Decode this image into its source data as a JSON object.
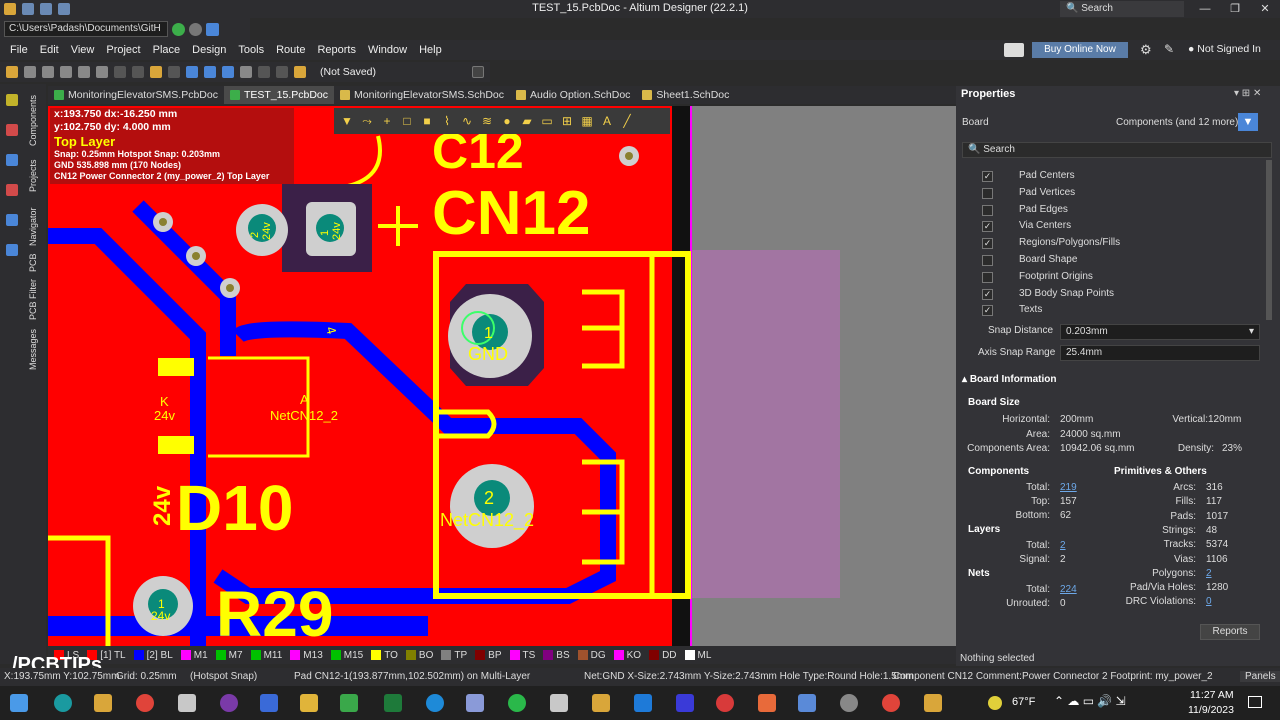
{
  "window": {
    "title": "TEST_15.PcbDoc - Altium Designer (22.2.1)",
    "search": "Search"
  },
  "path": "C:\\Users\\Padash\\Documents\\GitH",
  "menu": [
    "File",
    "Edit",
    "View",
    "Project",
    "Place",
    "Design",
    "Tools",
    "Route",
    "Reports",
    "Window",
    "Help"
  ],
  "top_right": {
    "buy": "Buy Online Now",
    "signin": "Not Signed In"
  },
  "toolbar": {
    "saved": "(Not Saved)"
  },
  "tabs": [
    "MonitoringElevatorSMS.PcbDoc",
    "TEST_15.PcbDoc",
    "MonitoringElevatorSMS.SchDoc",
    "Audio Option.SchDoc",
    "Sheet1.SchDoc"
  ],
  "left_panels": [
    "Components",
    "Projects",
    "Navigator",
    "PCB",
    "PCB Filter",
    "Messages"
  ],
  "info": {
    "l1": "x:193.750   dx:-16.250 mm",
    "l2": "y:102.750   dy:  4.000  mm",
    "layer": "Top Layer",
    "l3": "Snap: 0.25mm Hotspot Snap: 0.203mm",
    "l4": "GND  535.898 mm (170 Nodes)",
    "l5": "CN12  Power Connector 2 (my_power_2)  Top Layer"
  },
  "pcb": {
    "c12": "C12",
    "cn12": "CN12",
    "d10": "D10",
    "r29": "R29",
    "k": "K",
    "v24a": "24v",
    "a": "A",
    "net": "NetCN12_2",
    "v24b": "24v",
    "pad1": "1",
    "gnd": "GND",
    "pad2": "2",
    "net2": "NetCN12_2",
    "p1b": "1",
    "v24c": "24v",
    "p2a": "2",
    "v24d": "24v",
    "p1a": "1",
    "v24e": "24v",
    "four": "4"
  },
  "layers": [
    {
      "n": "LS",
      "c": "#ff0000"
    },
    {
      "n": "[1] TL",
      "c": "#ff0000"
    },
    {
      "n": "[2] BL",
      "c": "#0000ff"
    },
    {
      "n": "M1",
      "c": "#ff00ff"
    },
    {
      "n": "M7",
      "c": "#00c000"
    },
    {
      "n": "M11",
      "c": "#00c000"
    },
    {
      "n": "M13",
      "c": "#ff00ff"
    },
    {
      "n": "M15",
      "c": "#00c000"
    },
    {
      "n": "TO",
      "c": "#ffff00"
    },
    {
      "n": "BO",
      "c": "#808000"
    },
    {
      "n": "TP",
      "c": "#808080"
    },
    {
      "n": "BP",
      "c": "#800000"
    },
    {
      "n": "TS",
      "c": "#ff00ff"
    },
    {
      "n": "BS",
      "c": "#800080"
    },
    {
      "n": "DG",
      "c": "#a0522d"
    },
    {
      "n": "KO",
      "c": "#ff00ff"
    },
    {
      "n": "DD",
      "c": "#800000"
    },
    {
      "n": "ML",
      "c": "#ffffff"
    }
  ],
  "props": {
    "title": "Properties",
    "board": "Board",
    "components": "Components (and 12 more)",
    "search": "Search",
    "snap_items": [
      {
        "label": "Pad Centers",
        "checked": true
      },
      {
        "label": "Pad Vertices",
        "checked": false
      },
      {
        "label": "Pad Edges",
        "checked": false
      },
      {
        "label": "Via Centers",
        "checked": true
      },
      {
        "label": "Regions/Polygons/Fills",
        "checked": true
      },
      {
        "label": "Board Shape",
        "checked": false
      },
      {
        "label": "Footprint Origins",
        "checked": false
      },
      {
        "label": "3D Body Snap Points",
        "checked": true
      },
      {
        "label": "Texts",
        "checked": true
      }
    ],
    "snap_distance_label": "Snap Distance",
    "snap_distance": "0.203mm",
    "axis_label": "Axis Snap Range",
    "axis": "25.4mm",
    "board_info": "Board Information",
    "board_size": "Board Size",
    "horizontal_l": "Horizontal:",
    "horizontal": "200mm",
    "vertical_l": "Vertical:",
    "vertical": "120mm",
    "area_l": "Area:",
    "area": "24000 sq.mm",
    "comp_area_l": "Components Area:",
    "comp_area": "10942.06 sq.mm",
    "density_l": "Density:",
    "density": "23%",
    "components_h": "Components",
    "total_l": "Total:",
    "total": "219",
    "top_l": "Top:",
    "top": "157",
    "bottom_l": "Bottom:",
    "bottom": "62",
    "layers_h": "Layers",
    "ltotal_l": "Total:",
    "ltotal": "2",
    "signal_l": "Signal:",
    "signal": "2",
    "nets_h": "Nets",
    "ntotal_l": "Total:",
    "ntotal": "224",
    "unrouted_l": "Unrouted:",
    "unrouted": "0",
    "prims_h": "Primitives & Others",
    "arcs_l": "Arcs:",
    "arcs": "316",
    "fills_l": "Fills:",
    "fills": "117",
    "pads_l": "Pads:",
    "pads": "1017",
    "strings_l": "Strings:",
    "strings": "48",
    "tracks_l": "Tracks:",
    "tracks": "5374",
    "vias_l": "Vias:",
    "vias": "1106",
    "polygons_l": "Polygons:",
    "polygons": "2",
    "holes_l": "Pad/Via Holes:",
    "holes": "1280",
    "drc_l": "DRC Violations:",
    "drc": "0",
    "reports": "Reports",
    "nothing": "Nothing selected"
  },
  "status": {
    "coords": "X:193.75mm Y:102.75mm",
    "grid": "Grid: 0.25mm",
    "snap": "(Hotspot Snap)",
    "pad": "Pad CN12-1(193.877mm,102.502mm) on Multi-Layer",
    "net": "Net:GND X-Size:2.743mm Y-Size:2.743mm Hole Type:Round Hole:1.5mm",
    "comp": "Component CN12 Comment:Power Connector 2 Footprint: my_power_2",
    "panels": "Panels"
  },
  "taskbar": {
    "temp": "67°F",
    "time": "11:27 AM",
    "date": "11/9/2023"
  },
  "watermark": "/PCBTIPs"
}
